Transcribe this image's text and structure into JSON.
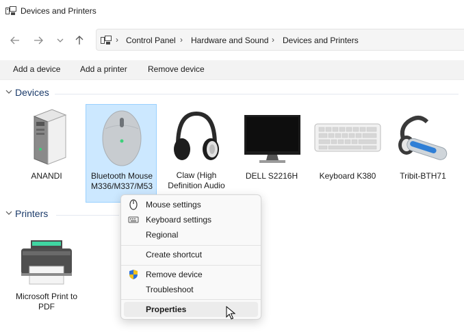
{
  "window": {
    "title": "Devices and Printers"
  },
  "nav": {
    "back_icon": "arrow-left-icon",
    "forward_icon": "arrow-right-icon",
    "recent_icon": "chevron-down-icon",
    "up_icon": "arrow-up-icon"
  },
  "breadcrumb": [
    "Control Panel",
    "Hardware and Sound",
    "Devices and Printers"
  ],
  "toolbar": {
    "add_device": "Add a device",
    "add_printer": "Add a printer",
    "remove_device": "Remove device"
  },
  "groups": {
    "devices": "Devices",
    "printers": "Printers"
  },
  "devices": [
    {
      "label": "ANANDI",
      "icon": "computer-tower-icon"
    },
    {
      "label": "Bluetooth Mouse M336/M337/M53",
      "icon": "mouse-icon",
      "selected": true
    },
    {
      "label": "Claw (High Definition Audio",
      "icon": "headphones-icon"
    },
    {
      "label": "DELL S2216H",
      "icon": "monitor-icon"
    },
    {
      "label": "Keyboard K380",
      "icon": "keyboard-icon"
    },
    {
      "label": "Tribit-BTH71",
      "icon": "bluetooth-headset-icon"
    }
  ],
  "printers": [
    {
      "label": "Microsoft Print to PDF",
      "icon": "printer-icon"
    }
  ],
  "context_menu": {
    "mouse_settings": "Mouse settings",
    "keyboard_settings": "Keyboard settings",
    "regional": "Regional",
    "create_shortcut": "Create shortcut",
    "remove_device": "Remove device",
    "troubleshoot": "Troubleshoot",
    "properties": "Properties"
  },
  "colors": {
    "selection_bg": "#cce8ff",
    "selection_border": "#99d1ff",
    "group_title": "#1a3a6a"
  }
}
